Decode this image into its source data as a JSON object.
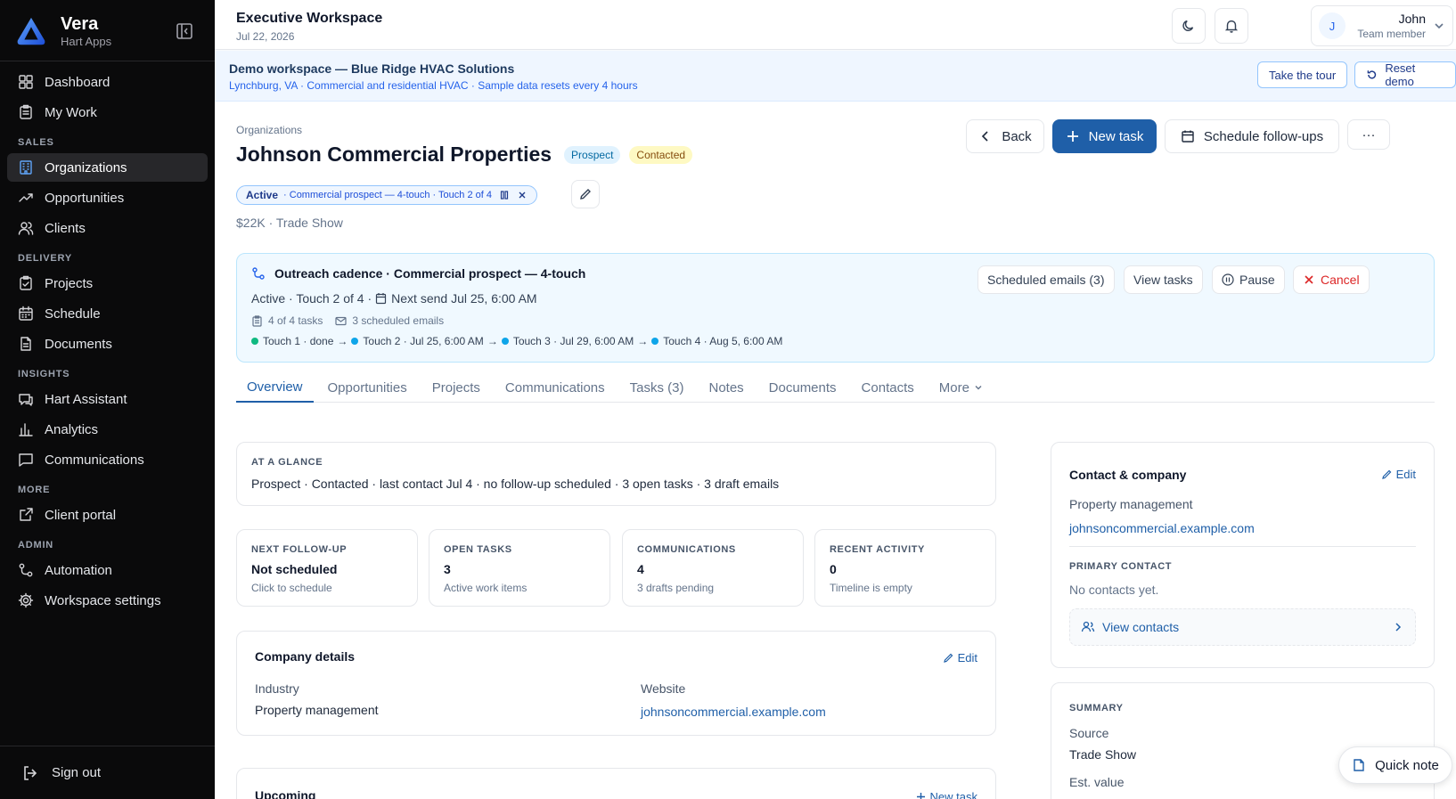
{
  "brand": {
    "name": "Vera",
    "sub": "Hart Apps"
  },
  "sidebar": {
    "items": [
      {
        "label": "Dashboard",
        "icon": "dashboard-icon"
      },
      {
        "label": "My Work",
        "icon": "clipboard-icon"
      },
      {
        "section": "SALES"
      },
      {
        "label": "Organizations",
        "icon": "building-icon",
        "active": true
      },
      {
        "label": "Opportunities",
        "icon": "trending-up-icon"
      },
      {
        "label": "Clients",
        "icon": "users-icon"
      },
      {
        "section": "DELIVERY"
      },
      {
        "label": "Projects",
        "icon": "clipboard-check-icon"
      },
      {
        "label": "Schedule",
        "icon": "calendar-icon"
      },
      {
        "label": "Documents",
        "icon": "document-icon"
      },
      {
        "section": "INSIGHTS"
      },
      {
        "label": "Hart Assistant",
        "icon": "chat-icon"
      },
      {
        "label": "Analytics",
        "icon": "bar-chart-icon"
      },
      {
        "label": "Communications",
        "icon": "message-icon"
      },
      {
        "section": "MORE"
      },
      {
        "label": "Client portal",
        "icon": "external-link-icon"
      },
      {
        "section": "ADMIN"
      },
      {
        "label": "Automation",
        "icon": "workflow-icon"
      },
      {
        "label": "Workspace settings",
        "icon": "gear-icon"
      }
    ],
    "signout": "Sign out"
  },
  "topbar": {
    "title": "Executive Workspace",
    "date": "Jul 22, 2026",
    "user": {
      "initial": "J",
      "name": "John",
      "role": "Team member"
    }
  },
  "demo": {
    "title": "Demo workspace — Blue Ridge HVAC Solutions",
    "sub": "Lynchburg, VA · Commercial and residential HVAC · Sample data resets every 4 hours",
    "tour": "Take the tour",
    "reset": "Reset demo"
  },
  "org": {
    "breadcrumb": "Organizations",
    "name": "Johnson Commercial Properties",
    "badges": [
      "Prospect",
      "Contacted"
    ],
    "sequence_status": "Active",
    "sequence_text": "· Commercial prospect — 4-touch · Touch 2 of 4",
    "meta": "$22K · Trade Show"
  },
  "actions": {
    "back": "Back",
    "new_task": "New task",
    "schedule": "Schedule follow-ups",
    "more": "···"
  },
  "cadence": {
    "title": "Outreach cadence · Commercial prospect — 4-touch",
    "status": "Active · Touch 2 of 4 ·",
    "next_send": "Next send Jul 25, 6:00 AM",
    "tasks": "4 of 4 tasks",
    "emails": "3 scheduled emails",
    "steps": [
      {
        "label": "Touch 1 · done",
        "color": "green"
      },
      {
        "label": "Touch 2 · Jul 25, 6:00 AM",
        "color": "blue"
      },
      {
        "label": "Touch 3 · Jul 29, 6:00 AM",
        "color": "blue"
      },
      {
        "label": "Touch 4 · Aug 5, 6:00 AM",
        "color": "blue"
      }
    ],
    "btn_scheduled": "Scheduled emails (3)",
    "btn_view": "View tasks",
    "btn_pause": "Pause",
    "btn_cancel": "Cancel"
  },
  "tabs": [
    "Overview",
    "Opportunities",
    "Projects",
    "Communications",
    "Tasks (3)",
    "Notes",
    "Documents",
    "Contacts",
    "More"
  ],
  "glance": {
    "label": "AT A GLANCE",
    "text": "Prospect · Contacted · last contact Jul 4 · no follow-up scheduled · 3 open tasks · 3 draft emails"
  },
  "stats": [
    {
      "label": "NEXT FOLLOW-UP",
      "value": "Not scheduled",
      "sub": "Click to schedule"
    },
    {
      "label": "OPEN TASKS",
      "value": "3",
      "sub": "Active work items"
    },
    {
      "label": "COMMUNICATIONS",
      "value": "4",
      "sub": "3 drafts pending"
    },
    {
      "label": "RECENT ACTIVITY",
      "value": "0",
      "sub": "Timeline is empty"
    }
  ],
  "company": {
    "title": "Company details",
    "edit": "Edit",
    "industry_label": "Industry",
    "industry": "Property management",
    "website_label": "Website",
    "website": "johnsoncommercial.example.com"
  },
  "upcoming": {
    "title": "Upcoming",
    "new_task": "New task"
  },
  "contact": {
    "title": "Contact & company",
    "edit": "Edit",
    "industry": "Property management",
    "website": "johnsoncommercial.example.com",
    "primary_label": "PRIMARY CONTACT",
    "primary_text": "No contacts yet.",
    "view_contacts": "View contacts"
  },
  "summary": {
    "label": "SUMMARY",
    "source_label": "Source",
    "source": "Trade Show",
    "est_label": "Est. value"
  },
  "quick_note": "Quick note",
  "colors": {
    "accent": "#1f5fa8",
    "sidebar": "#0a0a0b",
    "banner": "#eff6ff"
  }
}
